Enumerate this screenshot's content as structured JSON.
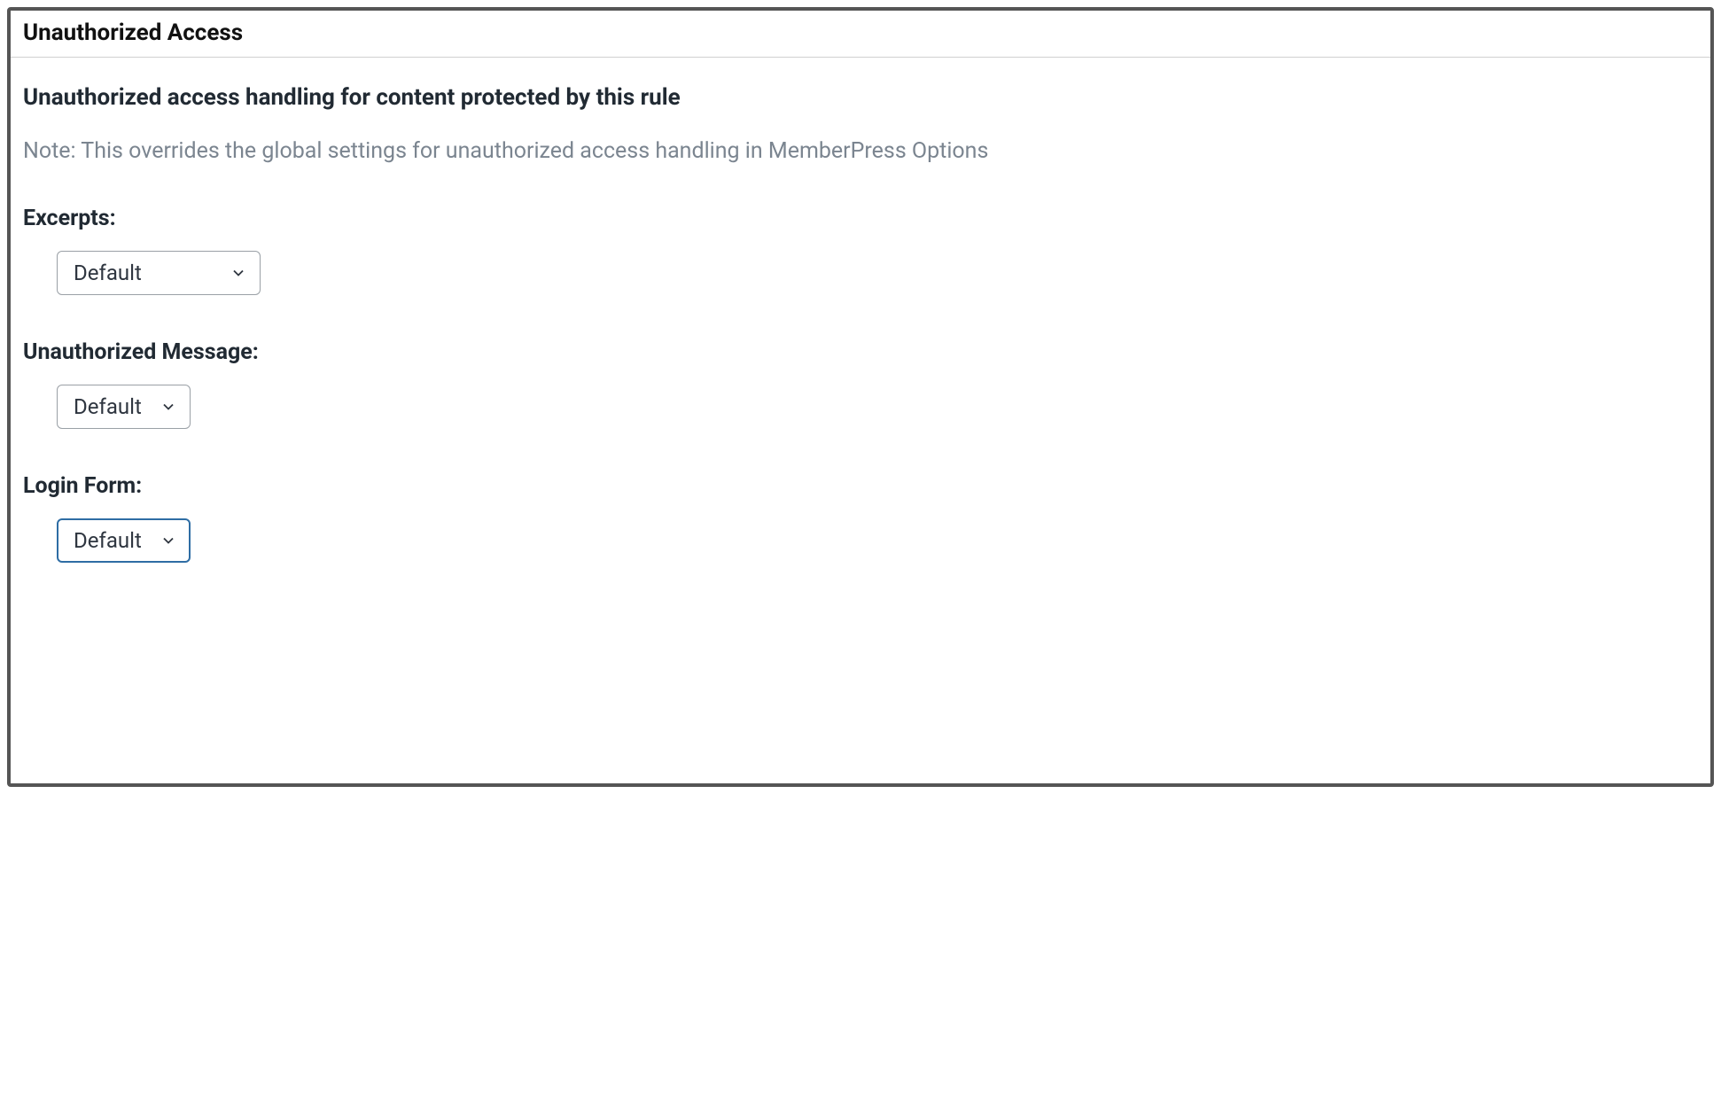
{
  "panel": {
    "title": "Unauthorized Access",
    "heading": "Unauthorized access handling for content protected by this rule",
    "note": "Note: This overrides the global settings for unauthorized access handling in MemberPress Options"
  },
  "fields": {
    "excerpts": {
      "label": "Excerpts:",
      "value": "Default"
    },
    "unauthorized_message": {
      "label": "Unauthorized Message:",
      "value": "Default"
    },
    "login_form": {
      "label": "Login Form:",
      "value": "Default"
    }
  }
}
